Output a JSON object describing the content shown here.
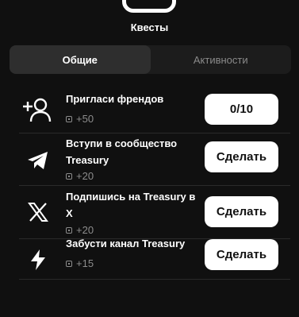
{
  "header": {
    "title": "Квесты",
    "icon": "rounded-square-icon"
  },
  "tabs": [
    {
      "label": "Общие",
      "active": true
    },
    {
      "label": "Активности",
      "active": false
    }
  ],
  "quests": [
    {
      "icon": "add-friend-icon",
      "title": "Пригласи френдов",
      "reward": "+50",
      "button": "0/10"
    },
    {
      "icon": "telegram-icon",
      "title": "Вступи в сообщество Treasury",
      "reward": "+20",
      "button": "Сделать"
    },
    {
      "icon": "x-logo-icon",
      "title": "Подпишись на Treasury в X",
      "reward": "+20",
      "button": "Сделать"
    },
    {
      "icon": "lightning-icon",
      "title": "Забусти канал Treasury",
      "reward": "+15",
      "button": "Сделать"
    }
  ],
  "colors": {
    "background": "#101010",
    "tab_bg": "#1c1c1c",
    "tab_active": "#2e2e2e",
    "muted": "#8c8c8c",
    "button_bg": "#ffffff"
  }
}
